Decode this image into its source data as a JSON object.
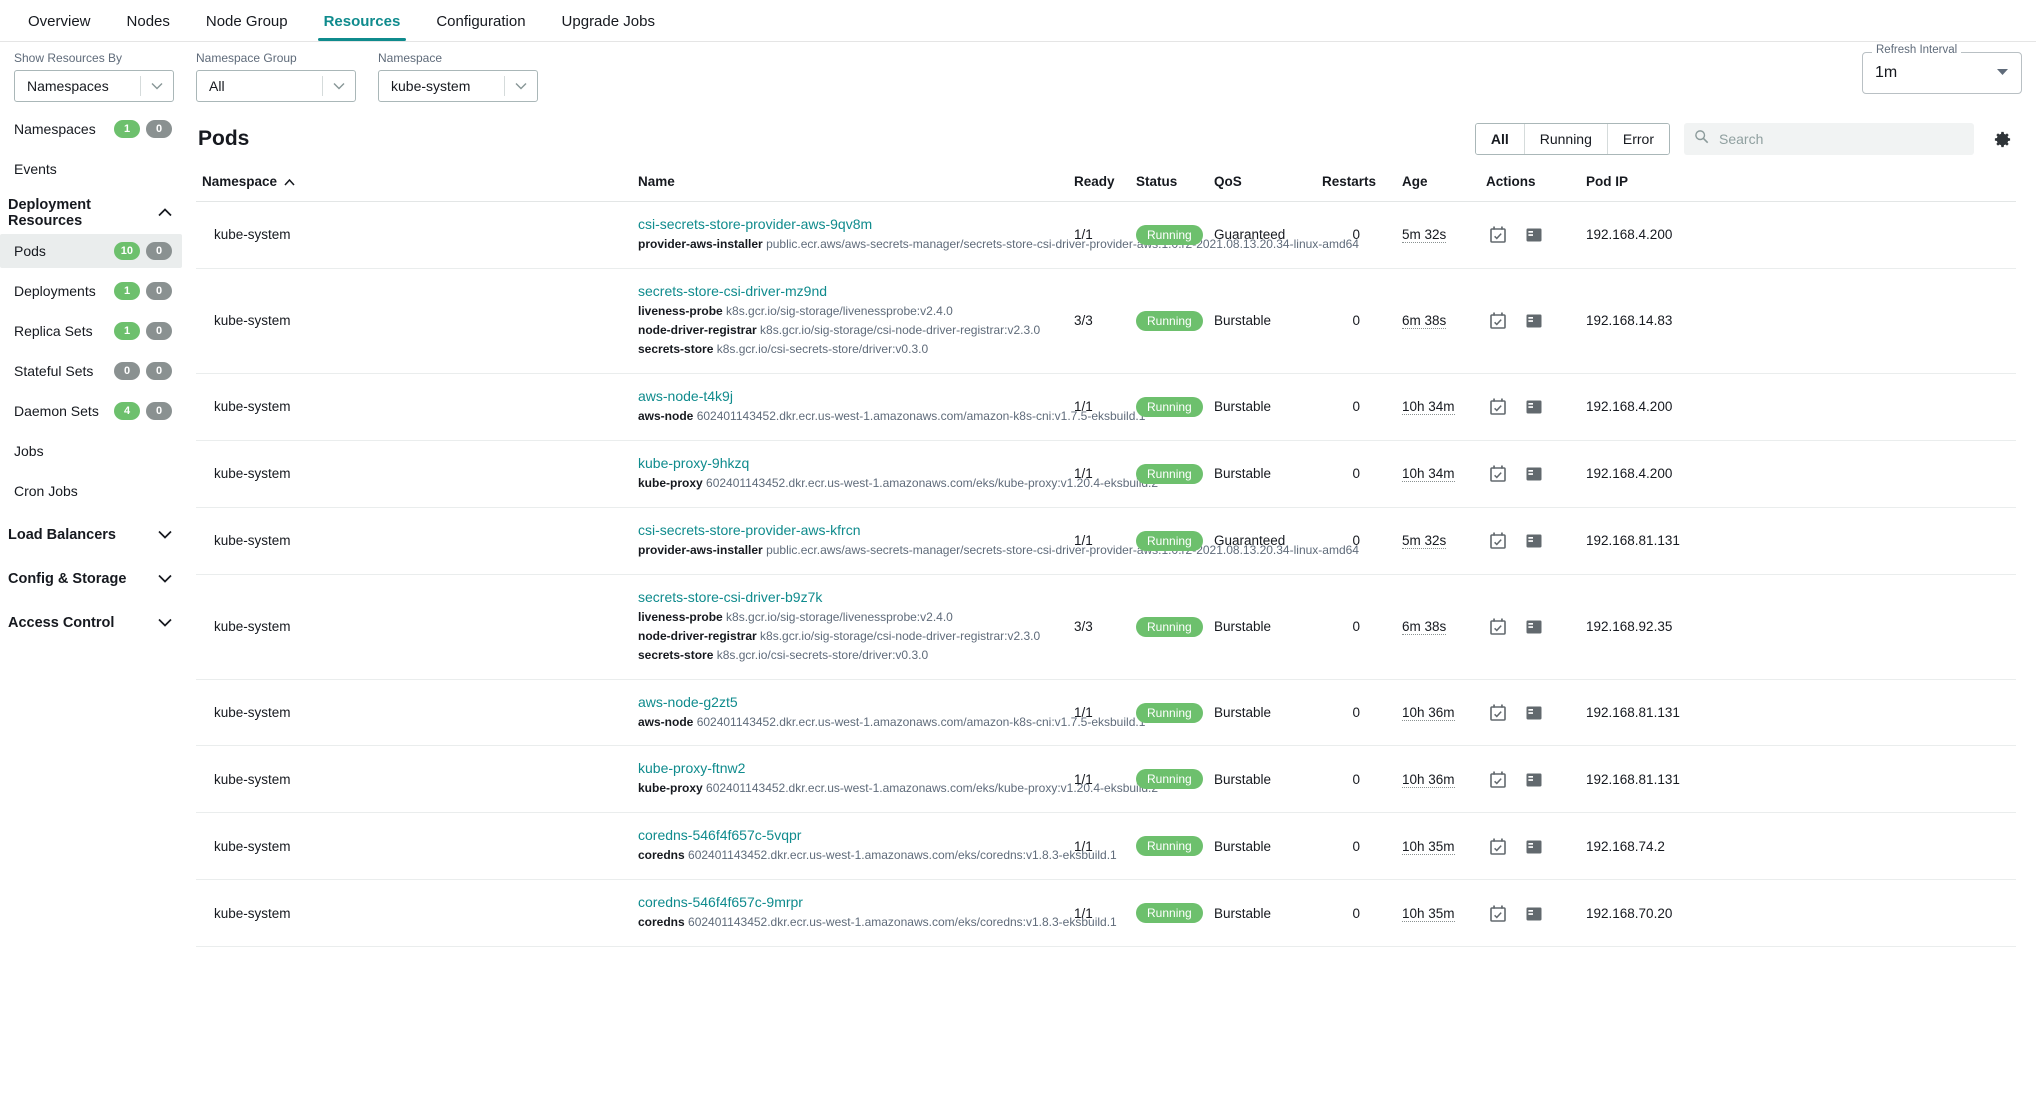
{
  "tabs": [
    {
      "label": "Overview",
      "active": false
    },
    {
      "label": "Nodes",
      "active": false
    },
    {
      "label": "Node Group",
      "active": false
    },
    {
      "label": "Resources",
      "active": true
    },
    {
      "label": "Configuration",
      "active": false
    },
    {
      "label": "Upgrade Jobs",
      "active": false
    }
  ],
  "filters": {
    "show_resources_by": {
      "label": "Show Resources By",
      "value": "Namespaces"
    },
    "namespace_group": {
      "label": "Namespace Group",
      "value": "All"
    },
    "namespace": {
      "label": "Namespace",
      "value": "kube-system"
    },
    "refresh_interval": {
      "label": "Refresh Interval",
      "value": "1m"
    }
  },
  "sidebar": {
    "top_items": [
      {
        "label": "Namespaces",
        "green": "1",
        "grey": "0",
        "selected": false
      },
      {
        "label": "Events",
        "selected": false
      }
    ],
    "sections": [
      {
        "label": "Deployment Resources",
        "expanded": true,
        "chevron": "∧",
        "items": [
          {
            "label": "Pods",
            "green": "10",
            "grey": "0",
            "selected": true
          },
          {
            "label": "Deployments",
            "green": "1",
            "grey": "0",
            "selected": false
          },
          {
            "label": "Replica Sets",
            "green": "1",
            "grey": "0",
            "selected": false
          },
          {
            "label": "Stateful Sets",
            "green": "0",
            "grey": "0",
            "green_zero": true,
            "selected": false
          },
          {
            "label": "Daemon Sets",
            "green": "4",
            "grey": "0",
            "selected": false
          },
          {
            "label": "Jobs",
            "selected": false
          },
          {
            "label": "Cron Jobs",
            "selected": false
          }
        ]
      },
      {
        "label": "Load Balancers",
        "expanded": false,
        "chevron": "∨",
        "items": []
      },
      {
        "label": "Config & Storage",
        "expanded": false,
        "chevron": "∨",
        "items": []
      },
      {
        "label": "Access Control",
        "expanded": false,
        "chevron": "∨",
        "items": []
      }
    ]
  },
  "panel": {
    "title": "Pods",
    "segmented": [
      {
        "label": "All",
        "active": true
      },
      {
        "label": "Running",
        "active": false
      },
      {
        "label": "Error",
        "active": false
      }
    ],
    "search": {
      "placeholder": "Search",
      "value": ""
    },
    "settings_icon": "gear-icon"
  },
  "table": {
    "columns": [
      {
        "key": "namespace",
        "label": "Namespace",
        "sorted": true,
        "sort_dir": "∧"
      },
      {
        "key": "name",
        "label": "Name"
      },
      {
        "key": "ready",
        "label": "Ready"
      },
      {
        "key": "status",
        "label": "Status"
      },
      {
        "key": "qos",
        "label": "QoS"
      },
      {
        "key": "restarts",
        "label": "Restarts"
      },
      {
        "key": "age",
        "label": "Age"
      },
      {
        "key": "actions",
        "label": "Actions"
      },
      {
        "key": "pod_ip",
        "label": "Pod IP"
      }
    ],
    "rows": [
      {
        "namespace": "kube-system",
        "name": "csi-secrets-store-provider-aws-9qv8m",
        "containers": [
          {
            "name": "provider-aws-installer",
            "image": "public.ecr.aws/aws-secrets-manager/secrets-store-csi-driver-provider-aws:1.0.r2-2021.08.13.20.34-linux-amd64"
          }
        ],
        "ready": "1/1",
        "status": "Running",
        "qos": "Guaranteed",
        "restarts": "0",
        "age": "5m 32s",
        "pod_ip": "192.168.4.200"
      },
      {
        "namespace": "kube-system",
        "name": "secrets-store-csi-driver-mz9nd",
        "containers": [
          {
            "name": "liveness-probe",
            "image": "k8s.gcr.io/sig-storage/livenessprobe:v2.4.0"
          },
          {
            "name": "node-driver-registrar",
            "image": "k8s.gcr.io/sig-storage/csi-node-driver-registrar:v2.3.0"
          },
          {
            "name": "secrets-store",
            "image": "k8s.gcr.io/csi-secrets-store/driver:v0.3.0"
          }
        ],
        "ready": "3/3",
        "status": "Running",
        "qos": "Burstable",
        "restarts": "0",
        "age": "6m 38s",
        "pod_ip": "192.168.14.83"
      },
      {
        "namespace": "kube-system",
        "name": "aws-node-t4k9j",
        "containers": [
          {
            "name": "aws-node",
            "image": "602401143452.dkr.ecr.us-west-1.amazonaws.com/amazon-k8s-cni:v1.7.5-eksbuild.1"
          }
        ],
        "ready": "1/1",
        "status": "Running",
        "qos": "Burstable",
        "restarts": "0",
        "age": "10h 34m",
        "pod_ip": "192.168.4.200"
      },
      {
        "namespace": "kube-system",
        "name": "kube-proxy-9hkzq",
        "containers": [
          {
            "name": "kube-proxy",
            "image": "602401143452.dkr.ecr.us-west-1.amazonaws.com/eks/kube-proxy:v1.20.4-eksbuild.2"
          }
        ],
        "ready": "1/1",
        "status": "Running",
        "qos": "Burstable",
        "restarts": "0",
        "age": "10h 34m",
        "pod_ip": "192.168.4.200"
      },
      {
        "namespace": "kube-system",
        "name": "csi-secrets-store-provider-aws-kfrcn",
        "containers": [
          {
            "name": "provider-aws-installer",
            "image": "public.ecr.aws/aws-secrets-manager/secrets-store-csi-driver-provider-aws:1.0.r2-2021.08.13.20.34-linux-amd64"
          }
        ],
        "ready": "1/1",
        "status": "Running",
        "qos": "Guaranteed",
        "restarts": "0",
        "age": "5m 32s",
        "pod_ip": "192.168.81.131"
      },
      {
        "namespace": "kube-system",
        "name": "secrets-store-csi-driver-b9z7k",
        "containers": [
          {
            "name": "liveness-probe",
            "image": "k8s.gcr.io/sig-storage/livenessprobe:v2.4.0"
          },
          {
            "name": "node-driver-registrar",
            "image": "k8s.gcr.io/sig-storage/csi-node-driver-registrar:v2.3.0"
          },
          {
            "name": "secrets-store",
            "image": "k8s.gcr.io/csi-secrets-store/driver:v0.3.0"
          }
        ],
        "ready": "3/3",
        "status": "Running",
        "qos": "Burstable",
        "restarts": "0",
        "age": "6m 38s",
        "pod_ip": "192.168.92.35"
      },
      {
        "namespace": "kube-system",
        "name": "aws-node-g2zt5",
        "containers": [
          {
            "name": "aws-node",
            "image": "602401143452.dkr.ecr.us-west-1.amazonaws.com/amazon-k8s-cni:v1.7.5-eksbuild.1"
          }
        ],
        "ready": "1/1",
        "status": "Running",
        "qos": "Burstable",
        "restarts": "0",
        "age": "10h 36m",
        "pod_ip": "192.168.81.131"
      },
      {
        "namespace": "kube-system",
        "name": "kube-proxy-ftnw2",
        "containers": [
          {
            "name": "kube-proxy",
            "image": "602401143452.dkr.ecr.us-west-1.amazonaws.com/eks/kube-proxy:v1.20.4-eksbuild.2"
          }
        ],
        "ready": "1/1",
        "status": "Running",
        "qos": "Burstable",
        "restarts": "0",
        "age": "10h 36m",
        "pod_ip": "192.168.81.131"
      },
      {
        "namespace": "kube-system",
        "name": "coredns-546f4f657c-5vqpr",
        "containers": [
          {
            "name": "coredns",
            "image": "602401143452.dkr.ecr.us-west-1.amazonaws.com/eks/coredns:v1.8.3-eksbuild.1"
          }
        ],
        "ready": "1/1",
        "status": "Running",
        "qos": "Burstable",
        "restarts": "0",
        "age": "10h 35m",
        "pod_ip": "192.168.74.2"
      },
      {
        "namespace": "kube-system",
        "name": "coredns-546f4f657c-9mrpr",
        "containers": [
          {
            "name": "coredns",
            "image": "602401143452.dkr.ecr.us-west-1.amazonaws.com/eks/coredns:v1.8.3-eksbuild.1"
          }
        ],
        "ready": "1/1",
        "status": "Running",
        "qos": "Burstable",
        "restarts": "0",
        "age": "10h 35m",
        "pod_ip": "192.168.70.20"
      }
    ],
    "row_actions": [
      {
        "icon": "events-calendar-icon",
        "title": "Events"
      },
      {
        "icon": "logs-icon",
        "title": "Logs"
      }
    ]
  },
  "colors": {
    "accent": "#0f8b8d",
    "status_running": "#6dc06d",
    "badge_grey": "#8a9191"
  }
}
